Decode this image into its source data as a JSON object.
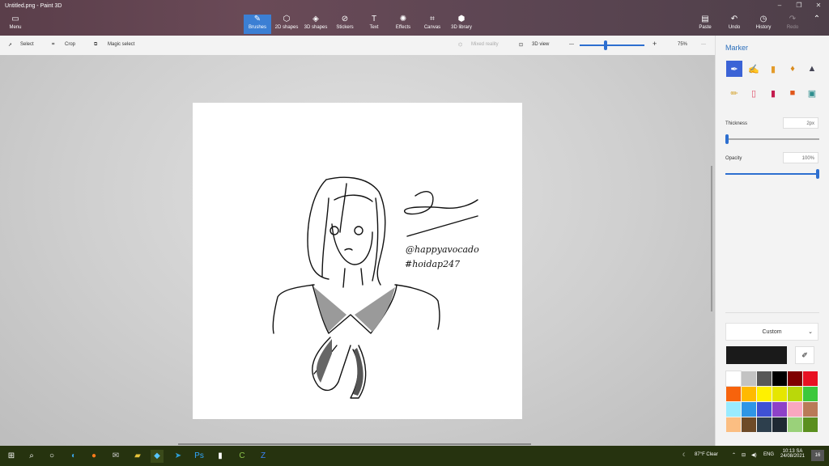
{
  "window": {
    "title": "Untitled.png - Paint 3D"
  },
  "ribbon": {
    "menu": {
      "label": "Menu",
      "icon": "folder-icon"
    },
    "tools": [
      {
        "label": "Brushes",
        "icon": "brush-icon",
        "active": true
      },
      {
        "label": "2D shapes",
        "icon": "2d-shapes-icon",
        "active": false
      },
      {
        "label": "3D shapes",
        "icon": "3d-shapes-icon",
        "active": false
      },
      {
        "label": "Stickers",
        "icon": "stickers-icon",
        "active": false
      },
      {
        "label": "Text",
        "icon": "text-icon",
        "active": false
      },
      {
        "label": "Effects",
        "icon": "effects-icon",
        "active": false
      },
      {
        "label": "Canvas",
        "icon": "canvas-icon",
        "active": false
      },
      {
        "label": "3D library",
        "icon": "3d-library-icon",
        "active": false
      }
    ],
    "paste": "Paste",
    "undo": "Undo",
    "history": "History",
    "redo": "Redo"
  },
  "subtoolbar": {
    "select": "Select",
    "crop": "Crop",
    "magic_select": "Magic select",
    "mixed_reality": "Mixed reality",
    "view_3d": "3D view",
    "zoom_minus": "—",
    "zoom_plus": "+",
    "zoom": "75%",
    "more": "···"
  },
  "panel": {
    "title": "Marker",
    "brushes": [
      "marker-icon",
      "calligraphy-pen-icon",
      "oil-brush-icon",
      "watercolor-icon",
      "pixel-pen-icon",
      "pencil-icon",
      "eraser-icon",
      "crayon-icon",
      "spray-can-icon",
      "fill-icon"
    ],
    "thickness_label": "Thickness",
    "thickness_value": "2px",
    "thickness_level": 0.03,
    "opacity_label": "Opacity",
    "opacity_value": "100%",
    "opacity_level": 1.0,
    "custom_label": "Custom",
    "current_color": "#1a1a1a",
    "swatches": [
      "#ffffff",
      "#c3c3c3",
      "#585858",
      "#000000",
      "#7f0000",
      "#e81123",
      "#f7630c",
      "#ffb900",
      "#fff100",
      "#e6e600",
      "#bad80a",
      "#3cc83c",
      "#99ebff",
      "#2f96e6",
      "#3f51d4",
      "#8e41c8",
      "#f9a7c0",
      "#b97a57",
      "#fbbe82",
      "#6e4b28",
      "#2d3f4d",
      "#1f2933",
      "#9ad17a",
      "#5a8f1e"
    ]
  },
  "canvas": {
    "signature_text": "@happyavocado",
    "hashtag_text": "#hoidap247"
  },
  "taskbar": {
    "weather": "87°F  Clear",
    "language": "ENG",
    "time": "10:13 SA",
    "date": "24/08/2021",
    "notifications": "16"
  }
}
